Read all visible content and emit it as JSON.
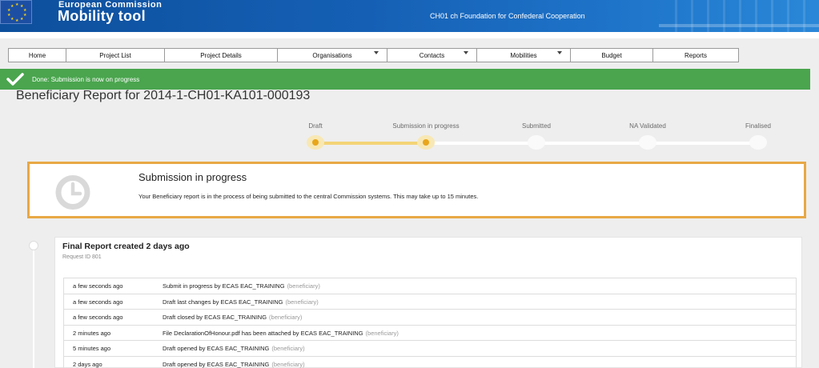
{
  "header": {
    "brand_top": "European Commission",
    "brand_main": "Mobility tool",
    "organisation": "CH01 ch Foundation for Confederal Cooperation"
  },
  "nav": {
    "items": [
      {
        "label": "Home",
        "dropdown": false
      },
      {
        "label": "Project List",
        "dropdown": false
      },
      {
        "label": "Project Details",
        "dropdown": false
      },
      {
        "label": "Organisations",
        "dropdown": true
      },
      {
        "label": "Contacts",
        "dropdown": true
      },
      {
        "label": "Mobilities",
        "dropdown": true
      },
      {
        "label": "Budget",
        "dropdown": false
      },
      {
        "label": "Reports",
        "dropdown": false
      }
    ]
  },
  "banner": {
    "message": "Done: Submission is now on progress",
    "color": "#4aa54e",
    "icon": "check-icon"
  },
  "page": {
    "title": "Beneficiary Report for 2014-1-CH01-KA101-000193"
  },
  "progress": {
    "steps": [
      {
        "label": "Draft",
        "done": true
      },
      {
        "label": "Submission in progress",
        "done": true
      },
      {
        "label": "Submitted",
        "done": false
      },
      {
        "label": "NA Validated",
        "done": false
      },
      {
        "label": "Finalised",
        "done": false
      }
    ],
    "accent": "#e8a61c"
  },
  "status": {
    "title": "Submission in progress",
    "text": "Your Beneficiary report is in the process of being submitted to the central Commission systems. This may take up to 15 minutes.",
    "icon": "clock-icon",
    "border_color": "#e8a845"
  },
  "report": {
    "title": "Final Report created 2 days ago",
    "request_id": "Request ID 801",
    "log": [
      {
        "time": "a few seconds ago",
        "desc": "Submit in progress by ECAS EAC_TRAINING",
        "role": "(beneficiary)"
      },
      {
        "time": "a few seconds ago",
        "desc": "Draft last changes by ECAS EAC_TRAINING",
        "role": "(beneficiary)"
      },
      {
        "time": "a few seconds ago",
        "desc": "Draft closed by ECAS EAC_TRAINING",
        "role": "(beneficiary)"
      },
      {
        "time": "2 minutes ago",
        "desc": "File DeclarationOfHonour.pdf has been attached by ECAS EAC_TRAINING",
        "role": "(beneficiary)"
      },
      {
        "time": "5 minutes ago",
        "desc": "Draft opened by ECAS EAC_TRAINING",
        "role": "(beneficiary)"
      },
      {
        "time": "2 days ago",
        "desc": "Draft opened by ECAS EAC_TRAINING",
        "role": "(beneficiary)"
      }
    ]
  }
}
